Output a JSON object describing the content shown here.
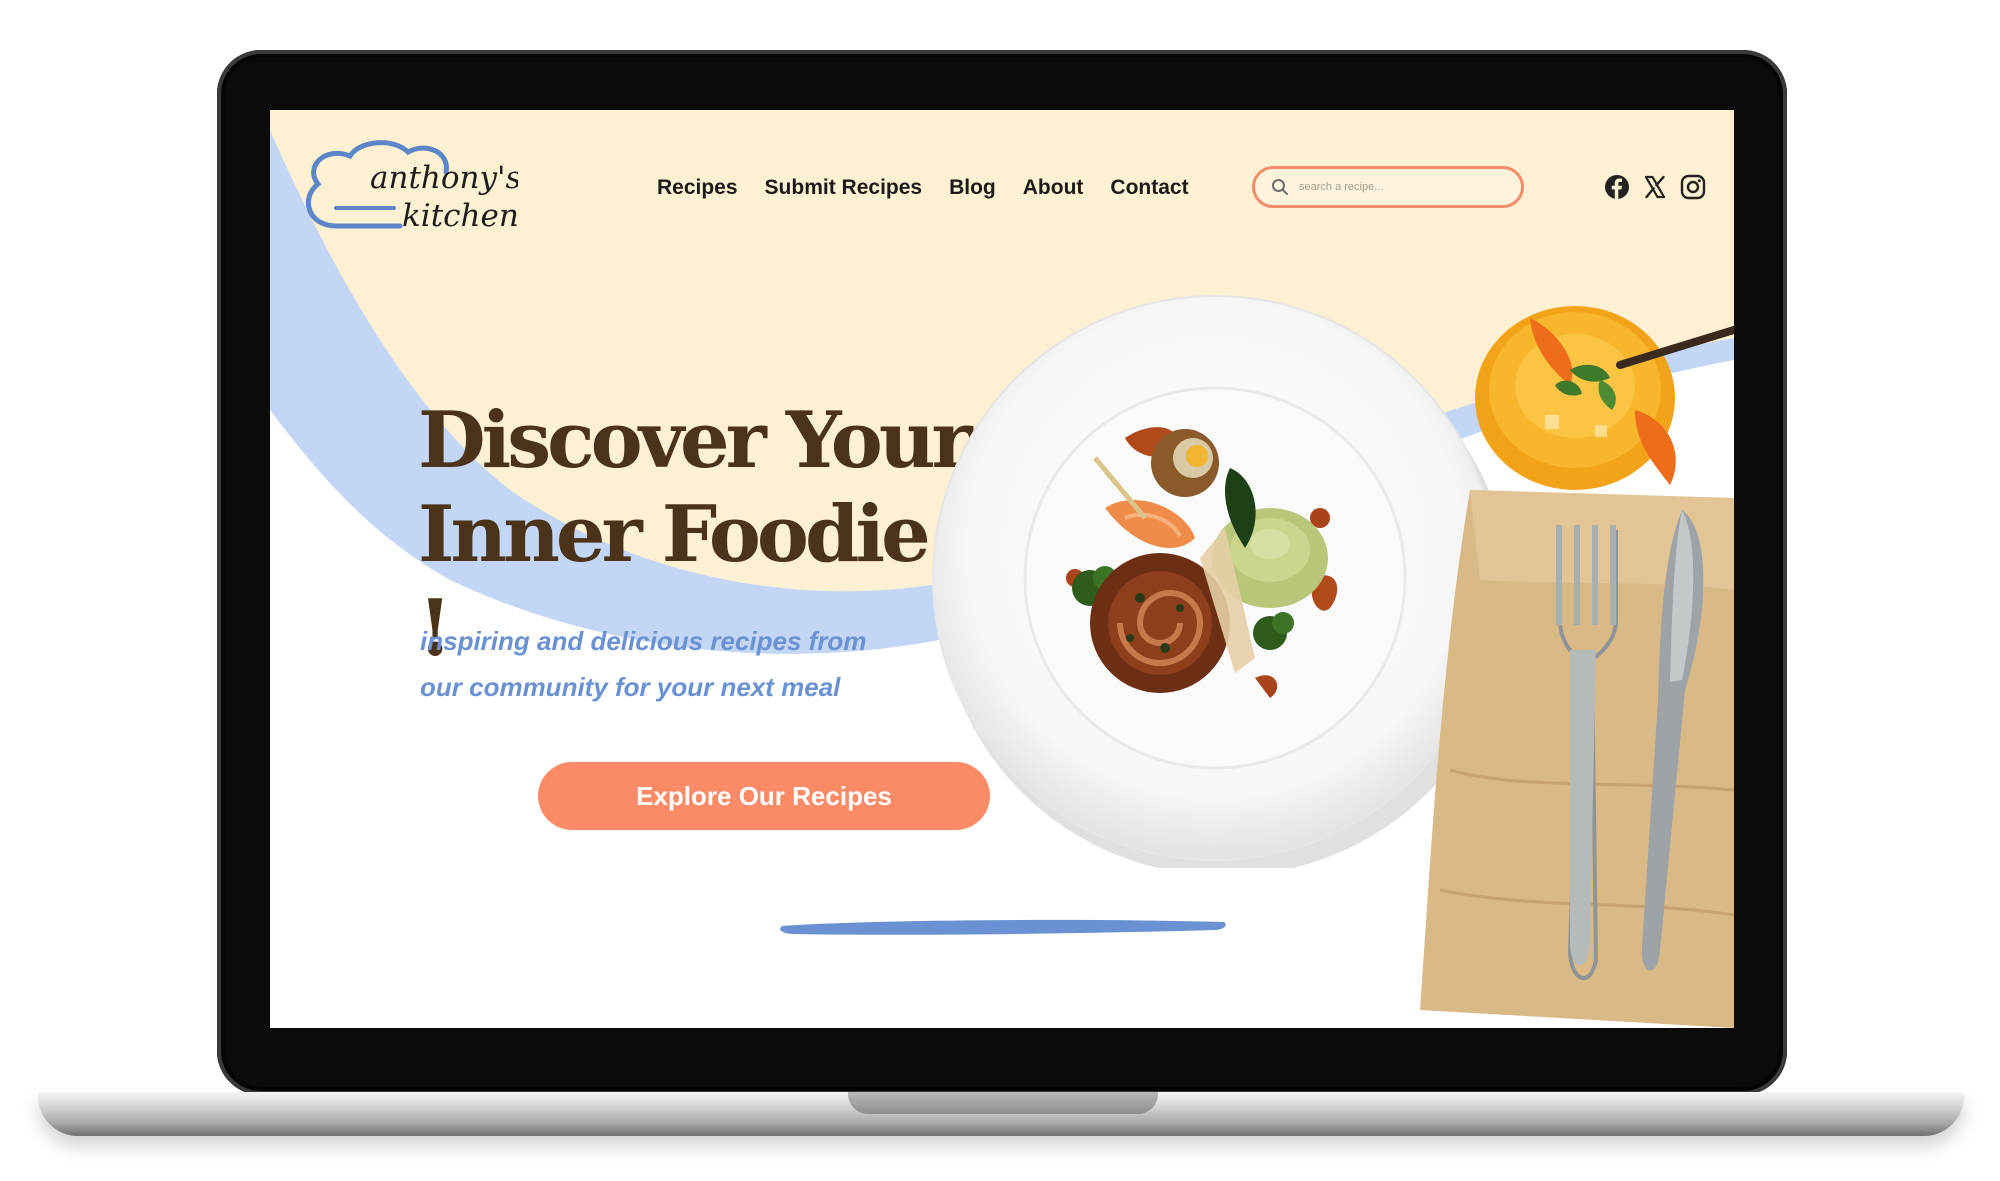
{
  "logo": {
    "line1": "anthony's",
    "line2": "kitchen"
  },
  "nav": {
    "items": [
      {
        "label": "Recipes"
      },
      {
        "label": "Submit Recipes"
      },
      {
        "label": "Blog"
      },
      {
        "label": "About"
      },
      {
        "label": "Contact"
      }
    ]
  },
  "search": {
    "placeholder": "search a recipe..."
  },
  "socials": [
    "facebook-icon",
    "x-icon",
    "instagram-icon"
  ],
  "hero": {
    "title_line1": "Discover Your",
    "title_line2": "Inner Foodie !",
    "subtitle_line1": "inspiring and delicious recipes from",
    "subtitle_line2": "our community for your next meal",
    "cta_label": "Explore Our Recipes"
  },
  "colors": {
    "cream": "#fdf0d3",
    "blue_swoosh": "#c3d6f6",
    "title": "#4a3318",
    "subtitle": "#6a92d2",
    "accent": "#fb8b66",
    "stroke": "#6a92d2"
  }
}
